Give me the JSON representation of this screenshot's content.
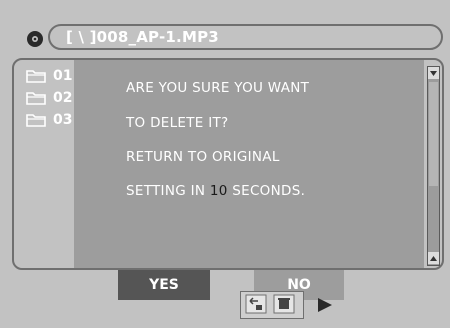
{
  "header": {
    "path": "[ \\ ]008_AP-1.MP3",
    "disc_icon": "disc-icon"
  },
  "file_list": {
    "items": [
      {
        "label": "01",
        "icon": "folder-icon"
      },
      {
        "label": "02",
        "icon": "folder-icon"
      },
      {
        "label": "03",
        "icon": "folder-icon"
      }
    ]
  },
  "dialog": {
    "line1": "ARE YOU SURE YOU WANT",
    "line2": "TO DELETE IT?",
    "line3": "RETURN TO ORIGINAL",
    "line4_prefix": "SETTING IN",
    "countdown": "10",
    "line4_suffix": "SECONDS.",
    "yes_label": "YES",
    "no_label": "NO"
  },
  "colors": {
    "background": "#c2c2c2",
    "dialog": "#9d9d9d",
    "selected_button": "#555555",
    "text": "#ffffff",
    "countdown": "#1a1a1a"
  }
}
